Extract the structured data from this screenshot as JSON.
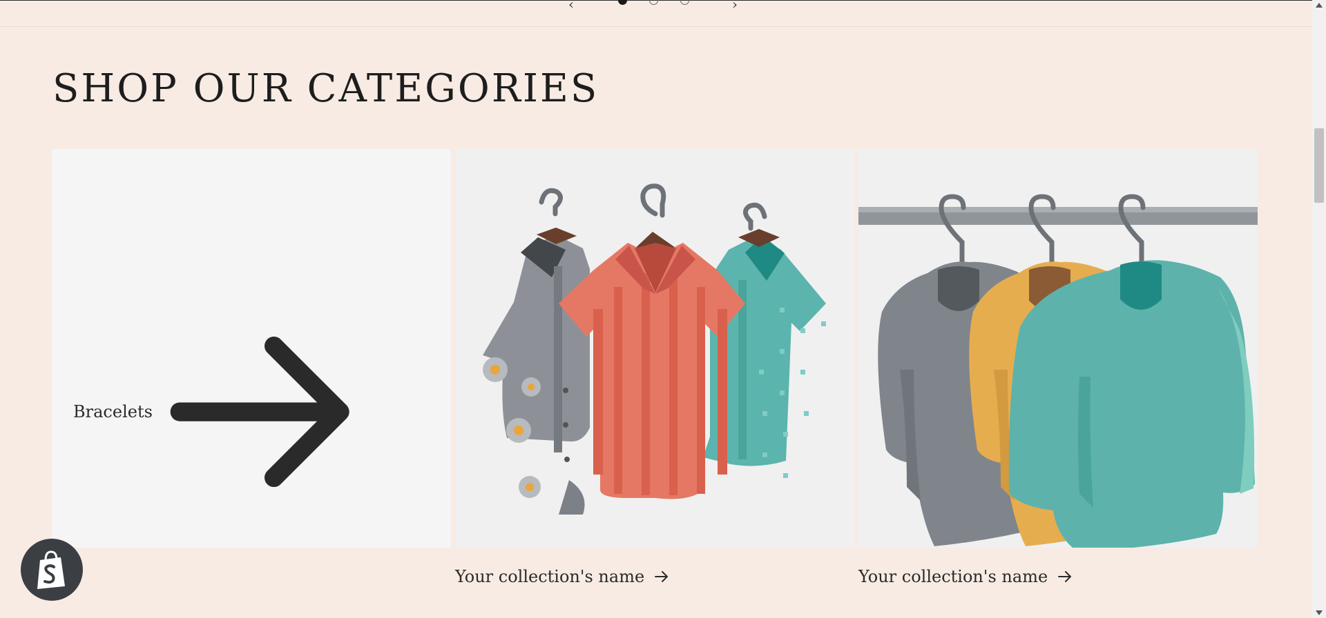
{
  "slider": {
    "prev_label": "‹",
    "next_label": "›",
    "dots": 3,
    "active_index": 0
  },
  "section": {
    "title": "SHOP OUR CATEGORIES"
  },
  "collections": [
    {
      "label": "Bracelets",
      "image": "none",
      "arrow": "arrow-right-icon"
    },
    {
      "label": "Your collection's name",
      "image": "shirts-on-hangers",
      "arrow": "arrow-right-icon"
    },
    {
      "label": "Your collection's name",
      "image": "sweaters-on-rack",
      "arrow": "arrow-right-icon"
    }
  ],
  "badge": {
    "icon": "shopify-bag-icon"
  },
  "colors": {
    "background": "#f7ebe4",
    "card_bg": "#f5f5f5",
    "badge_bg": "#3b3f43"
  }
}
